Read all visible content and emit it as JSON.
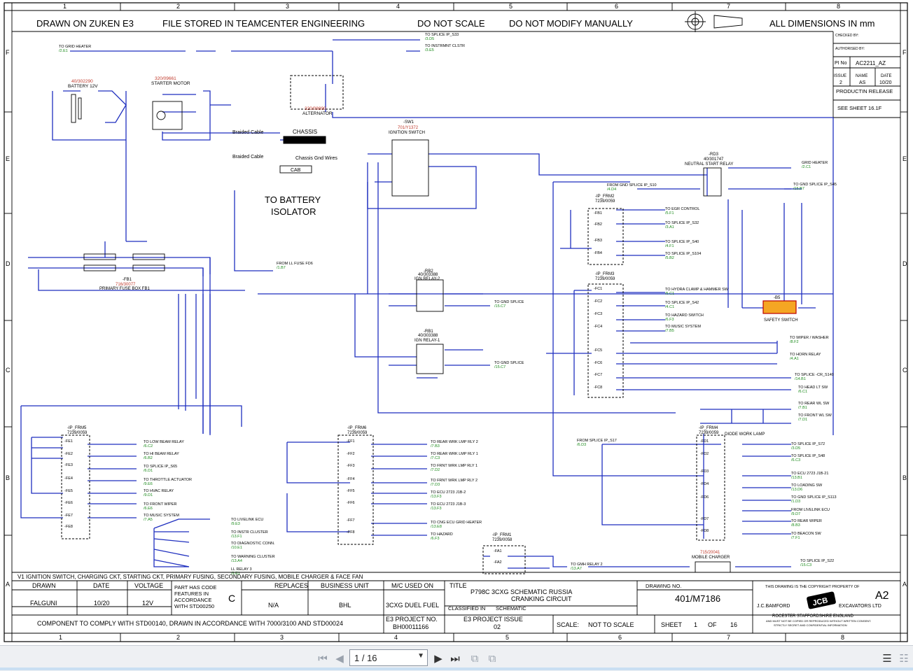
{
  "header": {
    "drawn_on": "DRAWN ON ZUKEN E3",
    "stored": "FILE STORED IN TEAMCENTER ENGINEERING",
    "no_scale": "DO NOT SCALE",
    "no_modify": "DO NOT MODIFY MANUALLY",
    "dimensions": "ALL DIMENSIONS IN mm"
  },
  "grid": {
    "columns": [
      "1",
      "2",
      "3",
      "4",
      "5",
      "6",
      "7",
      "8"
    ],
    "rows": [
      "F",
      "E",
      "D",
      "C",
      "B",
      "A"
    ]
  },
  "revision_box": {
    "checked_by": "CHECKED BY:",
    "authorised_by": "AUTHORISED BY:",
    "pi_no_label": "PI No",
    "pi_no": "AC2211_AZ",
    "issue_label": "ISSUE",
    "name_label": "NAME",
    "date_label": "DATE",
    "issue": "2",
    "name": "AS",
    "date": "10/20",
    "release": "PRODUCTIN RELEASE",
    "see_sheet": "SEE SHEET 16.1F"
  },
  "components": {
    "battery": {
      "part": "40/302290",
      "name": "BATTERY 12V"
    },
    "starter": {
      "part": "320/09661",
      "name": "STARTER MOTOR"
    },
    "alternator": {
      "part": "320/08890",
      "name": "ALTERNATOR"
    },
    "ignition": {
      "ref": "-SW1",
      "part": "701/Y1372",
      "name": "IGNITION SWITCH"
    },
    "neutral_relay": {
      "ref": "-RD3",
      "part": "40/301747",
      "name": "NEUTRAL START RELAY"
    },
    "relay2": {
      "ref": "-RB2",
      "part": "40/303388",
      "name": "IGN RELAY-2"
    },
    "relay1": {
      "ref": "-RB1",
      "part": "40/303388",
      "name": "IGN RELAY-1"
    },
    "fusebox": {
      "ref": "-FB1",
      "part": "716/30077",
      "name": "PRIMARY FUSE BOX FB1"
    },
    "safety": {
      "ref": "-B5",
      "name": "SAFETY SWITCH"
    },
    "charger": {
      "part": "715/20041",
      "name": "MOBILE CHARGER"
    },
    "chassis": "CHASSIS",
    "cab": "CAB",
    "braided": "Braided Cable",
    "gnd_wires": "Chassis Gnd Wires",
    "to_battery": "TO BATTERY",
    "isolator": "ISOLATOR",
    "diode_lamp": "DIODE WORK LAMP"
  },
  "fuse_banks": {
    "frm2": {
      "ref": "-IP_FRM2",
      "part": "7239/0059",
      "fuses": [
        "-FB1",
        "-FB2",
        "-FB3",
        "-FB4"
      ]
    },
    "frm3": {
      "ref": "-IP_FRM3",
      "part": "7239/0059",
      "fuses": [
        "-FC1",
        "-FC2",
        "-FC3",
        "-FC4",
        "-FC5",
        "-FC6",
        "-FC7",
        "-FC8"
      ]
    },
    "frm5": {
      "ref": "-IP_FRM5",
      "part": "7239/0059",
      "fuses": [
        "-FE1",
        "-FE2",
        "-FE3",
        "-FE4",
        "-FE5",
        "-FE6",
        "-FE7",
        "-FE8"
      ]
    },
    "frm6": {
      "ref": "-IP_FRM6",
      "part": "7239/0059",
      "fuses": [
        "-FF1",
        "-FF2",
        "-FF3",
        "-FF4",
        "-FF5",
        "-FF6",
        "-FF7",
        "-FF8"
      ]
    },
    "frm4": {
      "ref": "-IP_FRM4",
      "part": "7239/0059",
      "fuses": [
        "-FD1",
        "-FD2",
        "-FD3",
        "-FD4",
        "-FD6",
        "-FD7",
        "-FD8"
      ]
    },
    "frm1": {
      "ref": "-IP_FRM1",
      "part": "7239/0058",
      "fuses": [
        "-FA1",
        "-FA2"
      ]
    }
  },
  "destinations": {
    "frm2": [
      "TO EGR CONTROL",
      "TO SPLICE IP_S32",
      "TO SPLICE IP_S40",
      "TO SPLICE IP_S104"
    ],
    "frm2_refs": [
      "/5.F1",
      "/3.A1",
      "/4.F1",
      "/5.B2"
    ],
    "frm3": [
      "TO HYDRA CLAMP & HAMMER SW",
      "TO SPLICE IP_S42",
      "TO HAZARD SWITCH",
      "TO MUSIC SYSTEM"
    ],
    "frm3_refs": [
      "/5.C1",
      "/4.C1",
      "/6.F3",
      "/7.B5"
    ],
    "right_c": [
      "TO WIPER / WASHER",
      "TO HORN RELAY",
      "TO SPLICE -CR_S140",
      "TO HEAD LT SW",
      "TO REAR WL SW",
      "TO FRONT WL SW"
    ],
    "right_c_refs": [
      "/8.F2",
      "/4.A1",
      "/14.B1",
      "/6.C1",
      "/7.B1",
      "/7.D1"
    ],
    "frm5": [
      "TO LOW BEAM RELAY",
      "TO HI BEAM RELAY",
      "TO SPLICE IP_S65",
      "TO THROTTLE ACTUATOR",
      "TO HVAC RELAY",
      "TO FRONT WIPER",
      "TO MUSIC SYSTEM"
    ],
    "frm5_refs": [
      "/6.C2",
      "/6.B2",
      "/6.D1",
      "/9.E6",
      "/9.D1",
      "/6.E6",
      "/7.A5"
    ],
    "s98": [
      "TO LIVELINK ECU",
      "TO INSTR CLUSTER",
      "TO DIAGNOSTIC CONN.",
      "TO WARNING CLUSTER",
      "LL RELAY 3"
    ],
    "s98_refs": [
      "/9.E3",
      "/13.F1",
      "/10.E1",
      "/13.A4",
      "/9.E1"
    ],
    "frm6": [
      "TO REAR WRK LMP RLY 2",
      "TO REAR WRK LMP RLY 1",
      "TO FRNT WRK LMP RLY 1",
      "TO FRNT WRK LMP RLY 2",
      "TO ECU 2723 J1B-2",
      "TO ECU 2723 J1B-3",
      "TO CNG ECU GRID HEATER",
      "TO HAZARD"
    ],
    "frm6_refs": [
      "/7.B3",
      "/7.C3",
      "/7.D2",
      "/7.D3",
      "/13.F3",
      "/13.F3",
      "/13.E8",
      "/6.F3"
    ],
    "frm4": [
      "TO SPLICE IP_S72",
      "TO SPLICE IP_S48",
      "TO ECU 2723 J1B-21",
      "TO LOADING SW",
      "TO GND SPLICE IP_S113",
      "FROM LIVELINK ECU",
      "TO REAR WIPER",
      "TO BEACON SW"
    ],
    "frm4_refs": [
      "/3.D5",
      "/6.C3",
      "/13.B1",
      "/13.D6",
      "/1.D3",
      "/9.D7",
      "/8.B3",
      "/7.F1"
    ],
    "top": [
      "TO GRID HEATER",
      "TO SPLICE IP_S33",
      "TO INSTRMNT CLSTR",
      "GRID HEATER",
      "TO GND SPLICE IP_S45",
      "TO GND SPLICE",
      "TO GND SPLICE",
      "TO GMH RELAY 2",
      "TO SPLICE IP_S22",
      "FROM LL FUSE FD6",
      "FROM GND SPLICE IP_S10",
      "FROM SPLICE IP_S17"
    ],
    "top_refs": [
      "/2.E1",
      "/3.D5",
      "/3.E5",
      "/2.C1",
      "/15.B7",
      "/15.C7",
      "/15.C7",
      "/13.A7",
      "/15.C3",
      "/1.B7",
      "/4.D4",
      "/6.D3"
    ]
  },
  "title_block": {
    "v1_note": "V1   IGNITION SWITCH, CHARGING CKT, STARTING CKT, PRIMARY FUSING, SECONDARY FUSING, MOBILE CHARGER & FACE FAN",
    "drawn_label": "DRAWN",
    "drawn": "FALGUNI",
    "date_label": "DATE",
    "date": "10/20",
    "voltage_label": "VOLTAGE",
    "voltage": "12V",
    "part_code_1": "PART HAS CODE",
    "part_code_2": "FEATURES IN",
    "part_code_3": "ACCORDANCE",
    "part_code_4": "WITH STD00250",
    "code_letter": "C",
    "replaces_label": "REPLACES",
    "replaces": "N/A",
    "bu_label": "BUSINESS UNIT",
    "bu": "BHL",
    "mc_label": "M/C USED ON",
    "mc": "3CXG DUEL FUEL",
    "title_label": "TITLE",
    "title_1": "P798C 3CXG SCHEMATIC RUSSIA",
    "title_2": "CRANKING CIRCUIT",
    "classified_label": "CLASSIFIED IN",
    "classified": "SCHEMATIC",
    "drawing_no_label": "DRAWING NO.",
    "drawing_no": "401/M7186",
    "copyright": "THIS DRAWING IS THE COPYRIGHT PROPERTY OF",
    "size": "A2",
    "company": "J.C.BAMFORD",
    "company_2": "EXCAVATORS LTD",
    "addr": "ROCESTER     STAFFORDSHIRE      ENGLAND",
    "disclaimer_1": "AND MUST NOT BE COPIED OR REPRODUCED WITHOUT WRITTEN CONSENT.",
    "disclaimer_2": "STRICTLY SECRET AND CONFIDENTIAL INFORMATION",
    "std_note": "COMPONENT TO COMPLY WITH STD00140, DRAWN IN ACCORDANCE WITH 7000/3100 AND STD00024",
    "e3_label": "E3 PROJECT NO.",
    "e3": "BH00011166",
    "e3_issue_label": "E3 PROJECT ISSUE",
    "e3_issue": "02",
    "scale_label": "SCALE:",
    "scale": "NOT TO SCALE",
    "sheet_label": "SHEET",
    "sheet": "1",
    "of_label": "OF",
    "of": "16",
    "jcb": "JCB"
  },
  "viewer": {
    "page_indicator": "1 / 16",
    "colors": {
      "wire": "#1f2fbf",
      "ref": "#1a8a1a",
      "part": "#c0392b"
    }
  }
}
